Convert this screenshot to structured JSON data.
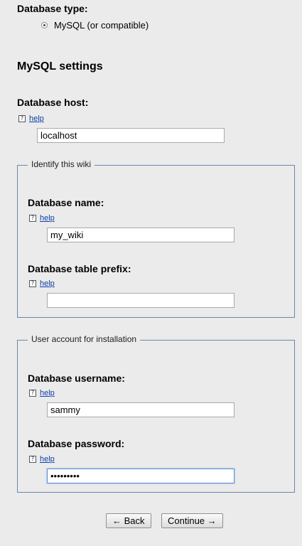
{
  "database_type": {
    "label": "Database type:",
    "option_label": "MySQL (or compatible)"
  },
  "mysql_section": {
    "title": "MySQL settings"
  },
  "help_text": "help",
  "help_icon_glyph": "?",
  "db_host": {
    "label": "Database host:",
    "value": "localhost"
  },
  "identify_wiki": {
    "legend": "Identify this wiki",
    "db_name": {
      "label": "Database name:",
      "value": "my_wiki"
    },
    "table_prefix": {
      "label": "Database table prefix:",
      "value": ""
    }
  },
  "install_account": {
    "legend": "User account for installation",
    "username": {
      "label": "Database username:",
      "value": "sammy"
    },
    "password": {
      "label": "Database password:",
      "value": "sammypass"
    }
  },
  "buttons": {
    "back": "← Back",
    "continue": "Continue →"
  },
  "colors": {
    "background": "#ebebeb",
    "link": "#0b3fa8",
    "fieldset_border": "#6a86a8",
    "focus_border": "#5b8fd6"
  }
}
